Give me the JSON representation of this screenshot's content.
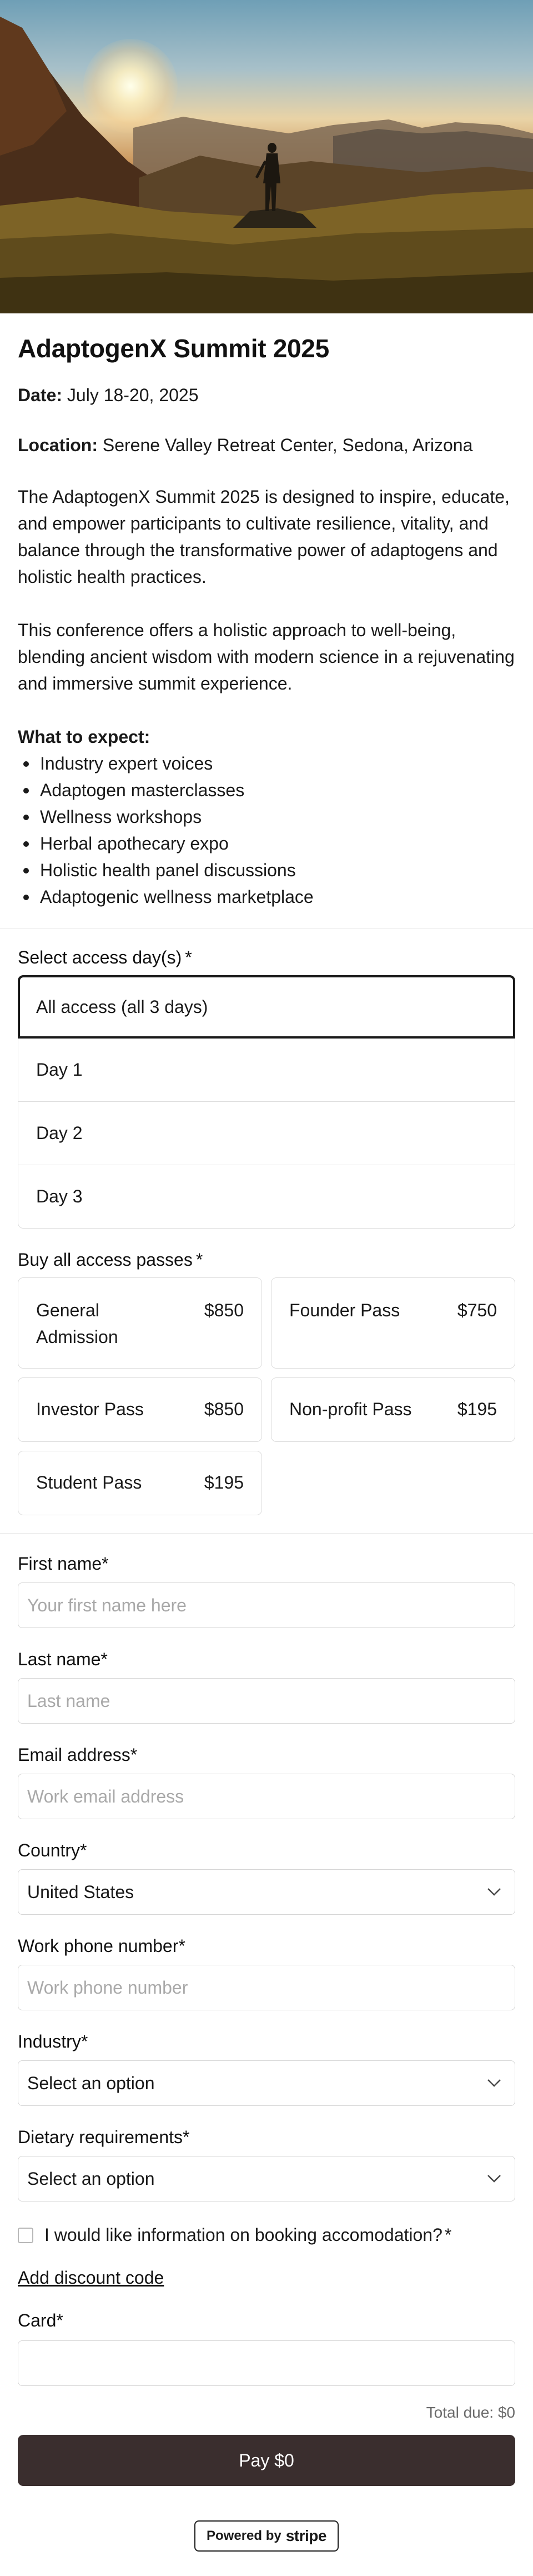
{
  "event": {
    "title": "AdaptogenX Summit 2025",
    "date_label": "Date:",
    "date_value": "July 18-20, 2025",
    "location_label": "Location:",
    "location_value": "Serene Valley Retreat Center, Sedona, Arizona",
    "paragraph_1": "The AdaptogenX Summit 2025 is designed to inspire, educate, and empower participants to cultivate resilience, vitality, and balance through the transformative power of adaptogens and holistic health practices.",
    "paragraph_2": "This conference offers a holistic approach to well-being, blending ancient wisdom with modern science in a rejuvenating and immersive summit experience.",
    "expect_title": "What to expect:",
    "expect_items": [
      "Industry expert voices",
      "Adaptogen masterclasses",
      "Wellness workshops",
      "Herbal apothecary expo",
      "Holistic health panel discussions",
      "Adaptogenic wellness marketplace"
    ]
  },
  "access": {
    "label": "Select access day(s)",
    "required": "*",
    "options": [
      "All access (all 3 days)",
      "Day 1",
      "Day 2",
      "Day 3"
    ],
    "selected_index": 0
  },
  "passes": {
    "label": "Buy all access passes",
    "required": "*",
    "items": [
      {
        "name": "General Admission",
        "price": "$850"
      },
      {
        "name": "Founder Pass",
        "price": "$750"
      },
      {
        "name": "Investor Pass",
        "price": "$850"
      },
      {
        "name": "Non-profit Pass",
        "price": "$195"
      },
      {
        "name": "Student Pass",
        "price": "$195"
      }
    ]
  },
  "form": {
    "first_name": {
      "label": "First name",
      "required": "*",
      "placeholder": "Your first name here",
      "value": ""
    },
    "last_name": {
      "label": "Last name",
      "required": "*",
      "placeholder": "Last name",
      "value": ""
    },
    "email": {
      "label": "Email address",
      "required": "*",
      "placeholder": "Work email address",
      "value": ""
    },
    "country": {
      "label": "Country",
      "required": "*",
      "value": "United States"
    },
    "phone": {
      "label": "Work phone number",
      "required": "*",
      "placeholder": "Work phone number",
      "value": ""
    },
    "industry": {
      "label": "Industry",
      "required": "*",
      "value": "Select an option"
    },
    "dietary": {
      "label": "Dietary requirements",
      "required": "*",
      "value": "Select an option"
    },
    "accommodation": {
      "label": "I would like information on booking accomodation?",
      "required": "*",
      "checked": false
    },
    "discount_link": "Add discount code",
    "card": {
      "label": "Card",
      "required": "*"
    }
  },
  "payment": {
    "total": "Total due: $0",
    "pay_button": "Pay $0",
    "powered_by": "Powered by",
    "brand": "stripe",
    "button_color": "#3a2e2e"
  },
  "icons": {
    "select_arrow": "chevron-down-icon",
    "checkbox": "checkbox-icon"
  }
}
